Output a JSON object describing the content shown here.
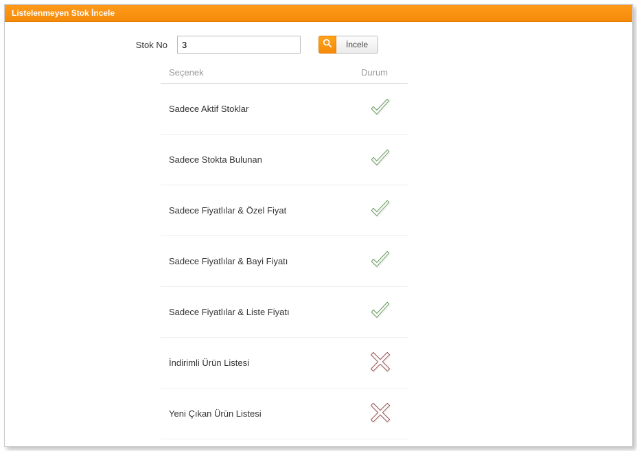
{
  "window": {
    "title": "Listelenmeyen Stok İncele"
  },
  "search": {
    "label": "Stok No",
    "value": "3",
    "button_label": "İncele"
  },
  "table": {
    "headers": {
      "option": "Seçenek",
      "status": "Durum"
    },
    "rows": [
      {
        "option": "Sadece Aktif Stoklar",
        "status": true
      },
      {
        "option": "Sadece Stokta Bulunan",
        "status": true
      },
      {
        "option": "Sadece Fiyatlılar & Özel Fiyat",
        "status": true
      },
      {
        "option": "Sadece Fiyatlılar & Bayi Fiyatı",
        "status": true
      },
      {
        "option": "Sadece Fiyatlılar & Liste Fiyatı",
        "status": true
      },
      {
        "option": "İndirimli Ürün Listesi",
        "status": false
      },
      {
        "option": "Yeni Çıkan Ürün Listesi",
        "status": false
      }
    ]
  }
}
